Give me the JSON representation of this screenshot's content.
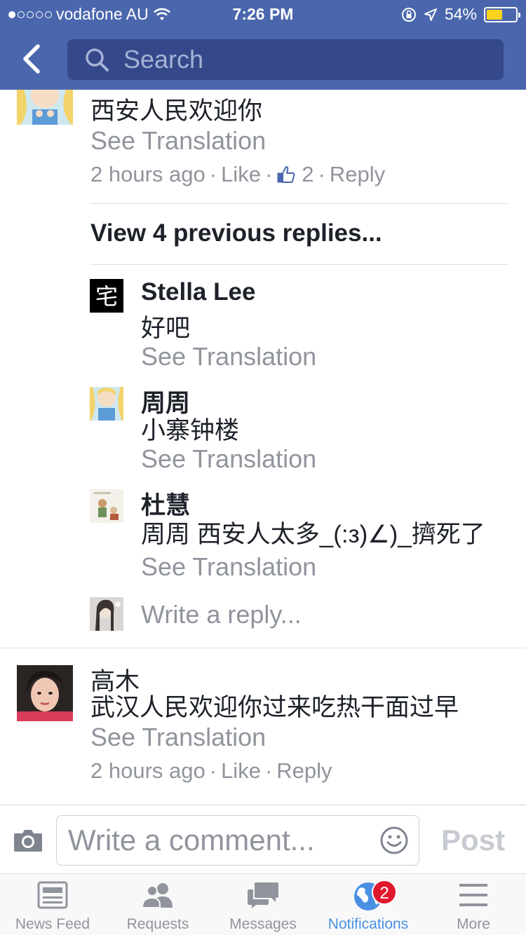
{
  "status_bar": {
    "carrier": "vodafone AU",
    "time": "7:26 PM",
    "battery": "54%",
    "battery_level": 0.54
  },
  "nav": {
    "search_placeholder": "Search",
    "back_icon": "chevron-left-icon"
  },
  "comment1": {
    "body": "西安人民欢迎你",
    "see_translation": "See Translation",
    "time": "2 hours ago",
    "like": "Like",
    "like_count": "2",
    "reply": "Reply"
  },
  "view_previous": "View 4 previous replies...",
  "replies": [
    {
      "name": "Stella Lee",
      "body": "好吧",
      "see_translation": "See Translation"
    },
    {
      "name": "周周",
      "body": "小寨钟楼",
      "see_translation": "See Translation"
    },
    {
      "name": "杜慧",
      "body": "周周 西安人太多_(:з)∠)_擠死了",
      "see_translation": "See Translation"
    }
  ],
  "write_reply_placeholder": "Write a reply...",
  "comment2": {
    "name": "高木",
    "body": "武汉人民欢迎你过来吃热干面过早",
    "see_translation": "See Translation",
    "time": "2 hours ago",
    "like": "Like",
    "reply": "Reply"
  },
  "composer": {
    "placeholder": "Write a comment...",
    "post_label": "Post"
  },
  "tabs": [
    {
      "label": "News Feed",
      "icon": "news-feed-icon"
    },
    {
      "label": "Requests",
      "icon": "friend-requests-icon"
    },
    {
      "label": "Messages",
      "icon": "messages-icon"
    },
    {
      "label": "Notifications",
      "icon": "globe-icon",
      "badge": "2",
      "active": true
    },
    {
      "label": "More",
      "icon": "hamburger-menu-icon"
    }
  ],
  "colors": {
    "header": "#4a67ad",
    "search_bg": "#35488a",
    "secondary_text": "#90949c",
    "active_tab": "#4a90e2",
    "badge": "#e0182d"
  }
}
